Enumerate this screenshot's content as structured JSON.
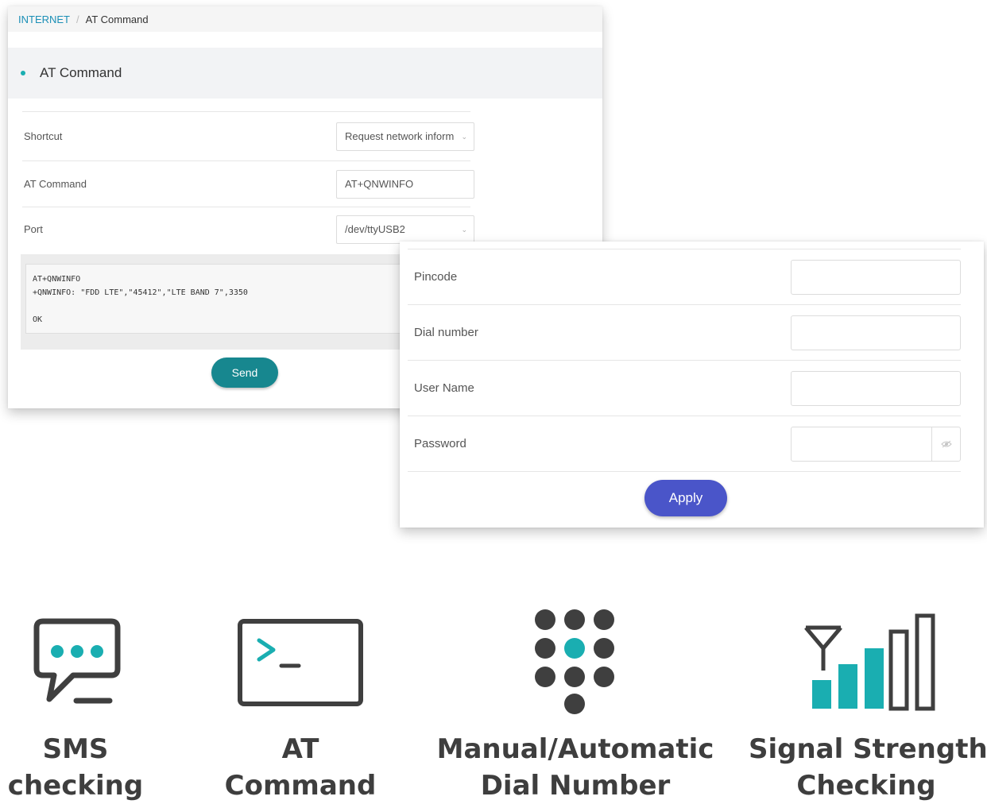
{
  "breadcrumb": {
    "section": "INTERNET",
    "separator": "/",
    "current": "AT Command"
  },
  "at_panel": {
    "title": "AT Command",
    "rows": [
      {
        "label": "Shortcut",
        "value": "Request network inform",
        "type": "select"
      },
      {
        "label": "AT Command",
        "value": "AT+QNWINFO",
        "type": "input"
      },
      {
        "label": "Port",
        "value": "/dev/ttyUSB2",
        "type": "select"
      }
    ],
    "output": "AT+QNWINFO\n+QNWINFO: \"FDD LTE\",\"45412\",\"LTE BAND 7\",3350\n\nOK",
    "send_label": "Send"
  },
  "dial_panel": {
    "rows": [
      {
        "label": "Pincode",
        "value": ""
      },
      {
        "label": "Dial number",
        "value": ""
      },
      {
        "label": "User Name",
        "value": ""
      },
      {
        "label": "Password",
        "value": ""
      }
    ],
    "apply_label": "Apply"
  },
  "features": [
    {
      "icon": "chat-bubble-icon",
      "line1": "SMS",
      "line2": "checking"
    },
    {
      "icon": "terminal-icon",
      "line1": "AT",
      "line2": "Command"
    },
    {
      "icon": "dialpad-icon",
      "line1": "Manual/Automatic",
      "line2": "Dial Number"
    },
    {
      "icon": "signal-strength-icon",
      "line1": "Signal Strength",
      "line2": "Checking"
    }
  ],
  "colors": {
    "teal": "#1aaeb1",
    "send": "#17878f",
    "apply": "#4a55c9",
    "icon_gray": "#3f3f3f"
  }
}
